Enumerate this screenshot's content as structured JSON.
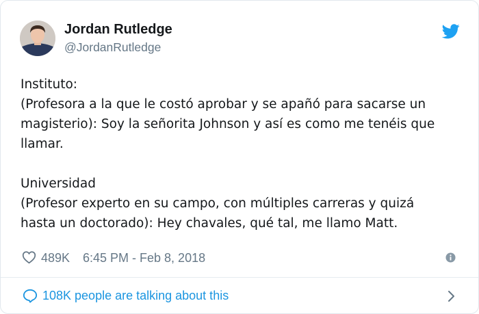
{
  "tweet": {
    "author": {
      "name": "Jordan Rutledge",
      "handle": "@JordanRutledge"
    },
    "text_lines": [
      "Instituto:",
      "(Profesora a la que le costó aprobar y se apañó para sacarse un",
      "magisterio): Soy la señorita Johnson y así es como me tenéis que",
      "llamar.",
      "",
      "Universidad",
      "(Profesor experto en su campo, con múltiples carreras y quizá",
      "hasta un doctorado): Hey chavales, qué tal, me llamo Matt."
    ],
    "likes": "489K",
    "timestamp": "6:45 PM - Feb 8, 2018"
  },
  "footer": {
    "talking_label": "108K people are talking about this"
  },
  "icons": {
    "bird": "twitter-bird-icon",
    "like": "heart-icon",
    "info": "info-icon",
    "reply": "speech-bubble-icon",
    "chevron": "chevron-right-icon"
  },
  "colors": {
    "brand": "#1da1f2",
    "link": "#1b95e0",
    "text": "#14171a",
    "secondary": "#657786",
    "border": "#e1e8ed"
  }
}
